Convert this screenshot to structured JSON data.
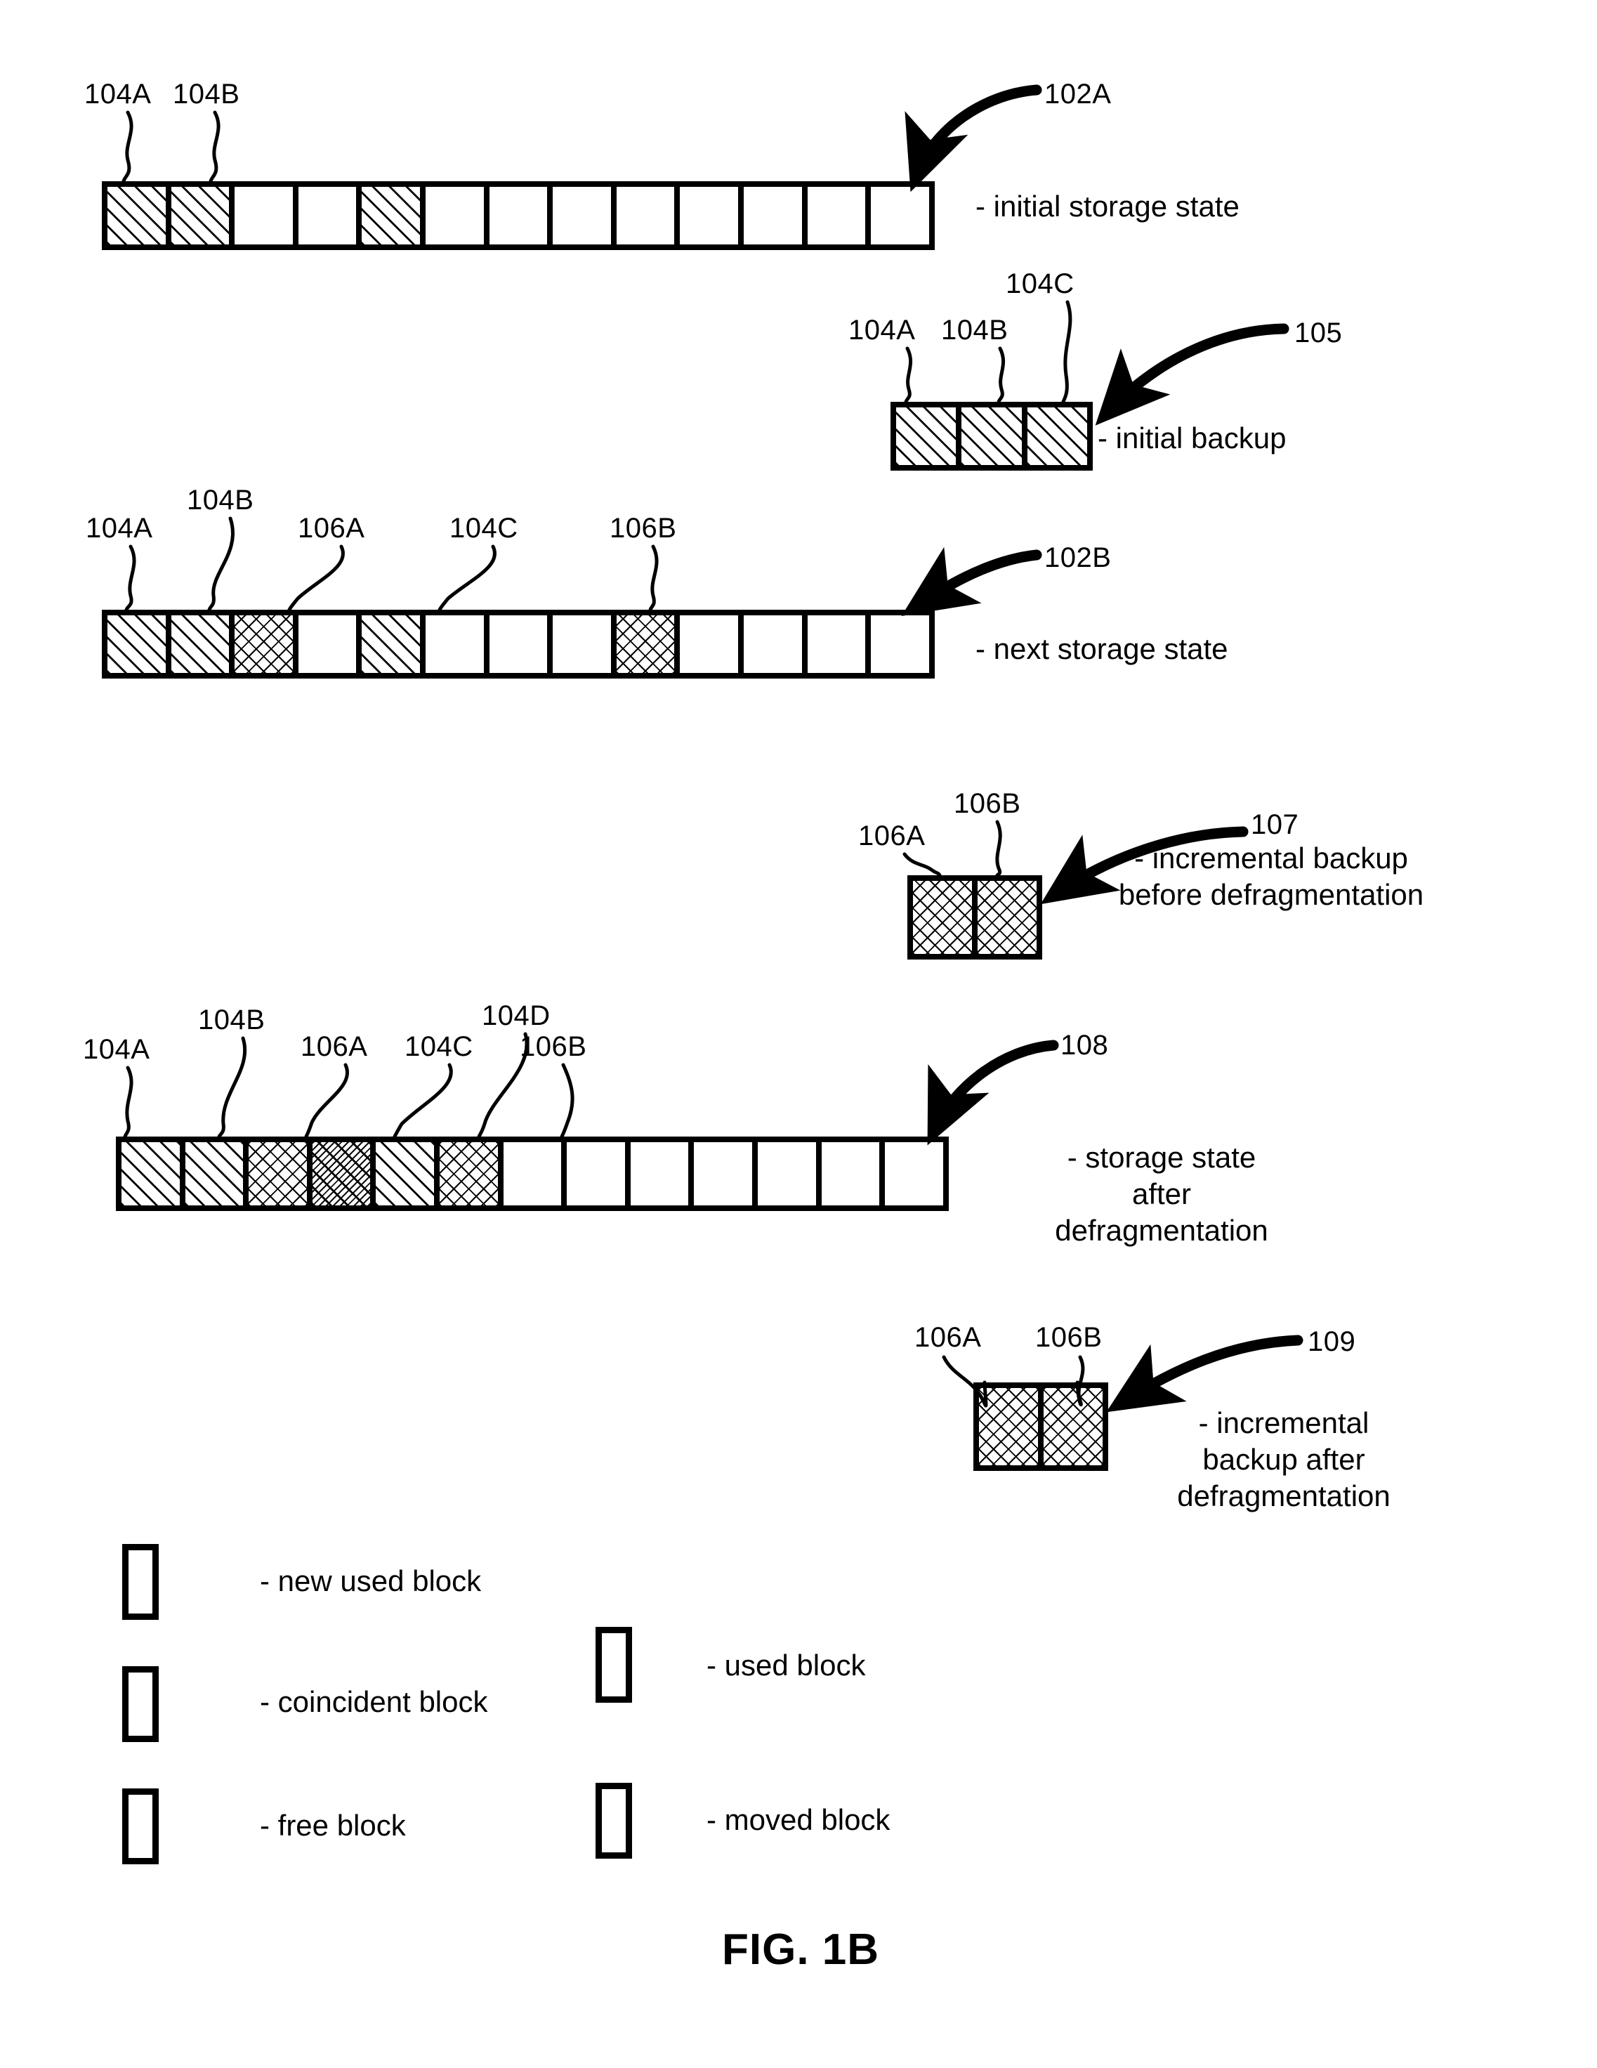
{
  "figure": {
    "caption": "FIG. 1B"
  },
  "legend": {
    "items": [
      {
        "pattern": "new",
        "label": "- new used block"
      },
      {
        "pattern": "coincident",
        "label": "- coincident block"
      },
      {
        "pattern": "free",
        "label": "- free block"
      },
      {
        "pattern": "used",
        "label": "- used block"
      },
      {
        "pattern": "moved",
        "label": "- moved block"
      }
    ]
  },
  "rows": [
    {
      "id": "initial-storage-state",
      "ref": "102A",
      "caption": "- initial storage state",
      "cells": [
        "used",
        "used",
        "free",
        "free",
        "used",
        "free",
        "free",
        "free",
        "free",
        "free",
        "free",
        "free",
        "free"
      ],
      "labels": [
        {
          "text": "104A",
          "cell": 0
        },
        {
          "text": "104B",
          "cell": 1
        }
      ]
    },
    {
      "id": "initial-backup",
      "ref": "105",
      "caption": "- initial backup",
      "cells": [
        "used",
        "used",
        "used"
      ],
      "labels": [
        {
          "text": "104A",
          "cell": 0
        },
        {
          "text": "104B",
          "cell": 1
        },
        {
          "text": "104C",
          "cell": 2
        }
      ]
    },
    {
      "id": "next-storage-state",
      "ref": "102B",
      "caption": "- next storage state",
      "cells": [
        "used",
        "used",
        "new",
        "free",
        "used",
        "free",
        "free",
        "free",
        "new",
        "free",
        "free",
        "free",
        "free"
      ],
      "labels": [
        {
          "text": "104A",
          "cell": 0
        },
        {
          "text": "104B",
          "cell": 1
        },
        {
          "text": "106A",
          "cell": 2
        },
        {
          "text": "104C",
          "cell": 4
        },
        {
          "text": "106B",
          "cell": 8
        }
      ]
    },
    {
      "id": "incremental-backup-before-defragmentation",
      "ref": "107",
      "caption": "- incremental backup\nbefore defragmentation",
      "cells": [
        "new",
        "new"
      ],
      "labels": [
        {
          "text": "106A",
          "cell": 0
        },
        {
          "text": "106B",
          "cell": 1
        }
      ]
    },
    {
      "id": "storage-state-after-defragmentation",
      "ref": "108",
      "caption": "- storage state\nafter\ndefragmentation",
      "cells": [
        "used",
        "used",
        "new",
        "moved",
        "used",
        "new",
        "free",
        "free",
        "free",
        "free",
        "free",
        "free",
        "free"
      ],
      "labels": [
        {
          "text": "104A",
          "cell": 0
        },
        {
          "text": "104B",
          "cell": 1
        },
        {
          "text": "106A",
          "cell": 2
        },
        {
          "text": "104C",
          "cell": 3
        },
        {
          "text": "104D",
          "cell": 4
        },
        {
          "text": "106B",
          "cell": 5
        }
      ]
    },
    {
      "id": "incremental-backup-after-defragmentation",
      "ref": "109",
      "caption": "- incremental\nbackup after\ndefragmentation",
      "cells": [
        "new",
        "new"
      ],
      "labels": [
        {
          "text": "106A",
          "cell": 0
        },
        {
          "text": "106B",
          "cell": 1
        }
      ]
    }
  ]
}
